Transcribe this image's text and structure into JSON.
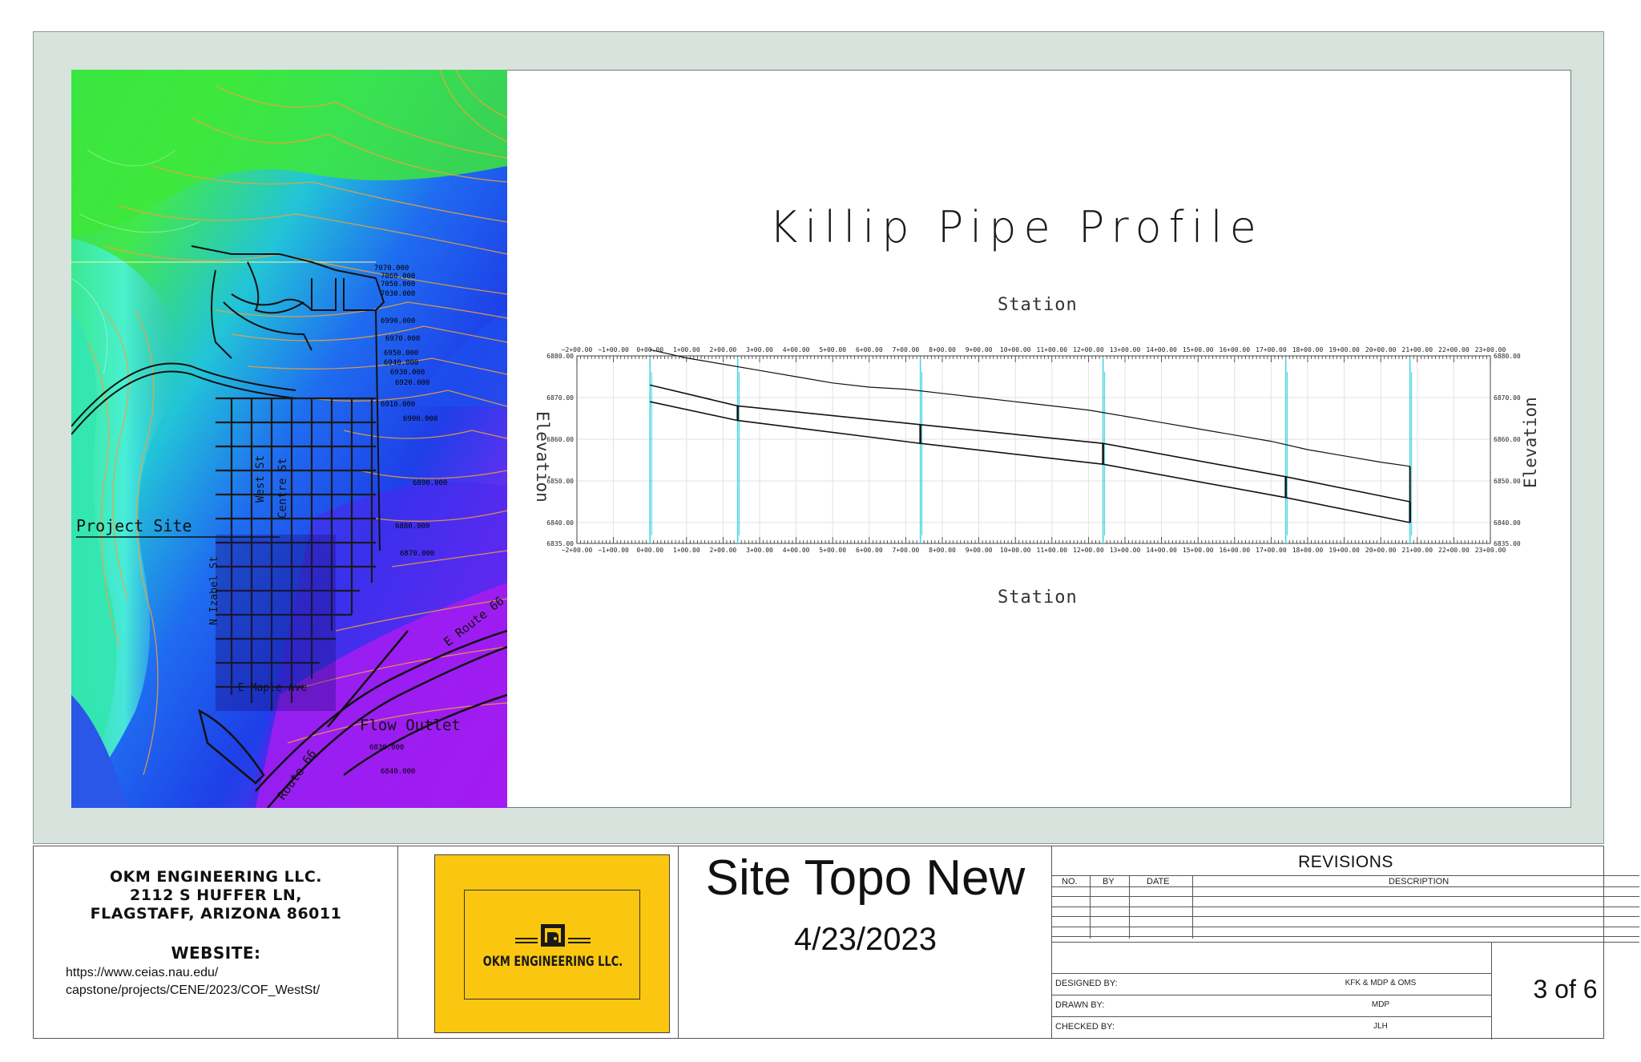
{
  "profile": {
    "title": "Killip Pipe Profile",
    "station_top": "Station",
    "station_bottom": "Station",
    "elevation_label": "Elevation"
  },
  "chart_data": {
    "type": "line",
    "title": "Killip Pipe Profile",
    "xlabel": "Station",
    "ylabel": "Elevation",
    "xlim": [
      -200,
      2300
    ],
    "ylim": [
      6835,
      6880
    ],
    "x_ticks": [
      "−2+00.00",
      "−1+00.00",
      "0+00.00",
      "1+00.00",
      "2+00.00",
      "3+00.00",
      "4+00.00",
      "5+00.00",
      "6+00.00",
      "7+00.00",
      "8+00.00",
      "9+00.00",
      "10+00.00",
      "11+00.00",
      "12+00.00",
      "13+00.00",
      "14+00.00",
      "15+00.00",
      "16+00.00",
      "17+00.00",
      "18+00.00",
      "19+00.00",
      "20+00.00",
      "21+00.00",
      "22+00.00",
      "23+00.00"
    ],
    "y_ticks": [
      "6835.00",
      "6840.00",
      "6850.00",
      "6860.00",
      "6870.00",
      "6880.00"
    ],
    "series": [
      {
        "x": [
          0,
          100,
          200,
          300,
          400,
          500,
          600,
          700,
          800,
          900,
          1000,
          1100,
          1200,
          1300,
          1400,
          1500,
          1600,
          1700,
          1800,
          1900,
          2000,
          2080
        ],
        "y": [
          6881.5,
          6879.5,
          6878.0,
          6876.5,
          6875.0,
          6873.5,
          6872.5,
          6872.0,
          6871.0,
          6870.0,
          6869.0,
          6868.0,
          6867.0,
          6865.5,
          6864.0,
          6862.5,
          6861.0,
          6859.5,
          6857.5,
          6856.0,
          6854.5,
          6853.5
        ]
      },
      {
        "x": [
          0,
          240,
          740,
          1240,
          1740,
          2080
        ],
        "y": [
          6873.0,
          6868.0,
          6863.5,
          6859.0,
          6851.0,
          6845.0
        ]
      },
      {
        "x": [
          0,
          240,
          740,
          1240,
          1740,
          2080
        ],
        "y": [
          6869.0,
          6864.5,
          6859.0,
          6854.0,
          6846.0,
          6840.0
        ]
      }
    ],
    "structures_x": [
      0,
      240,
      740,
      1240,
      1740,
      2080
    ],
    "grid": true
  },
  "map": {
    "labels": {
      "project_site": "Project Site",
      "flow_outlet": "Flow Outlet",
      "route66_a": "E Route 66",
      "route66_b": "Route 66",
      "west_st": "West St",
      "centre_st": "Centre St",
      "n_izabel_st": "N Izabel St",
      "e_maple_ave": "E Maple Ave"
    },
    "contours": [
      "7070.000",
      "7060.000",
      "7050.000",
      "7040.000",
      "7030.000",
      "7020.000",
      "6990.000",
      "6980.000",
      "6970.000",
      "6950.000",
      "6940.000",
      "6930.000",
      "6920.000",
      "6910.000",
      "6900.000",
      "6890.000",
      "6880.000",
      "6870.000",
      "6860.000",
      "6850.000",
      "6840.000",
      "6830.000"
    ]
  },
  "title_block": {
    "company_name": "OKM ENGINEERING LLC.",
    "address_line1": "2112 S HUFFER LN,",
    "address_line2": "FLAGSTAFF, ARIZONA 86011",
    "website_label": "WEBSITE:",
    "website_url_line1": "https://www.ceias.nau.edu/",
    "website_url_line2": "capstone/projects/CENE/2023/COF_WestSt/",
    "logo_text": "OKM ENGINEERING LLC.",
    "logo_color": "#fbc60f",
    "sheet_title": "Site Topo New",
    "sheet_date": "4/23/2023",
    "revisions_title": "REVISIONS",
    "rev_headers": {
      "no": "NO.",
      "by": "BY",
      "date": "DATE",
      "description": "DESCRIPTION"
    },
    "designed_by_label": "DESIGNED BY:",
    "designed_by_value": "KFK & MDP & OMS",
    "drawn_by_label": "DRAWN BY:",
    "drawn_by_value": "MDP",
    "checked_by_label": "CHECKED BY:",
    "checked_by_value": "JLH",
    "sheet_number": "3 of 6"
  }
}
